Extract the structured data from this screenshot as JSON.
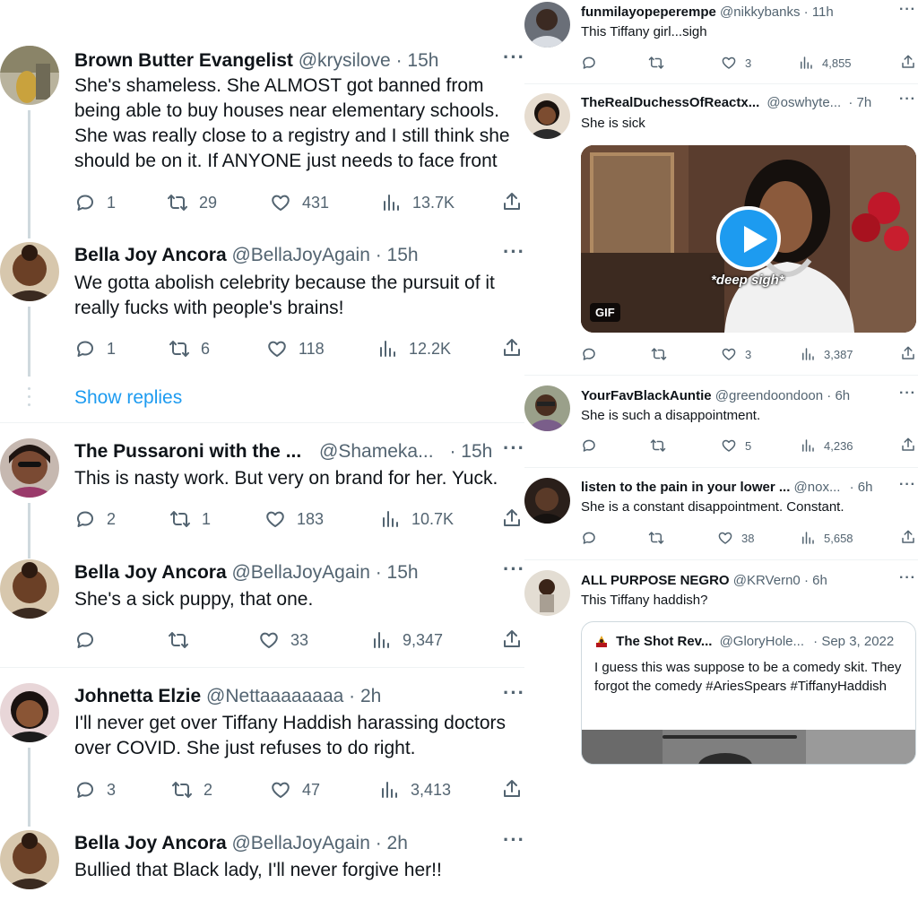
{
  "left": {
    "tweets": [
      {
        "name": "Brown Butter Evangelist",
        "handle": "@krysilove",
        "time": "· 15h",
        "text": "She's shameless. She ALMOST got banned from being able to buy houses near elementary schools. She was really close to a registry and I still think she should be on it. If ANYONE just needs to face front",
        "replies": "1",
        "retweets": "29",
        "likes": "431",
        "views": "13.7K"
      },
      {
        "name": "Bella Joy Ancora",
        "handle": "@BellaJoyAgain",
        "time": "· 15h",
        "text": "We gotta abolish celebrity because the pursuit of it really fucks with people's brains!",
        "replies": "1",
        "retweets": "6",
        "likes": "118",
        "views": "12.2K"
      },
      {
        "name": "The Pussaroni with the ...",
        "handle": "@Shameka...",
        "time": "· 15h",
        "text": "This is nasty work. But very on brand for her. Yuck.",
        "replies": "2",
        "retweets": "1",
        "likes": "183",
        "views": "10.7K"
      },
      {
        "name": "Bella Joy Ancora",
        "handle": "@BellaJoyAgain",
        "time": "· 15h",
        "text": "She's a sick puppy, that one.",
        "replies": "",
        "retweets": "",
        "likes": "33",
        "views": "9,347"
      },
      {
        "name": "Johnetta Elzie",
        "handle": "@Nettaaaaaaaa",
        "time": "· 2h",
        "text": "I'll never get over Tiffany Haddish harassing doctors over COVID. She just refuses to do right.",
        "replies": "3",
        "retweets": "2",
        "likes": "47",
        "views": "3,413"
      },
      {
        "name": "Bella Joy Ancora",
        "handle": "@BellaJoyAgain",
        "time": "· 2h",
        "text": "Bullied that Black lady, I'll never forgive her!!"
      }
    ],
    "show_replies": "Show replies"
  },
  "right": {
    "tweets": [
      {
        "name": "funmilayopeperempe",
        "handle": "@nikkybanks",
        "time": "· 11h",
        "text": "This Tiffany girl...sigh",
        "replies": "",
        "retweets": "",
        "likes": "3",
        "views": "4,855"
      },
      {
        "name": "TheRealDuchessOfReactx...",
        "handle": "@oswhyte...",
        "time": "· 7h",
        "text": "She is sick",
        "replies": "",
        "retweets": "",
        "likes": "3",
        "views": "3,387",
        "gif_badge": "GIF",
        "gif_caption": "*deep sigh*"
      },
      {
        "name": "YourFavBlackAuntie",
        "handle": "@greendoondoon",
        "time": "· 6h",
        "text": "She is such a disappointment.",
        "replies": "",
        "retweets": "",
        "likes": "5",
        "views": "4,236"
      },
      {
        "name": "listen to the pain in your lower ...",
        "handle": "@nox...",
        "time": "· 6h",
        "text": "She is a constant disappointment. Constant.",
        "replies": "",
        "retweets": "",
        "likes": "38",
        "views": "5,658"
      },
      {
        "name": "ALL PURPOSE NEGRO",
        "handle": "@KRVern0",
        "time": "· 6h",
        "text": "This Tiffany haddish?"
      }
    ],
    "quote": {
      "name": "The Shot Rev...",
      "handle": "@GloryHole...",
      "date": "· Sep 3, 2022",
      "text": "I guess this was suppose to be a comedy skit. They forgot the comedy #AriesSpears #TiffanyHaddish"
    }
  },
  "colors": {
    "accent": "#1d9bf0",
    "muted": "#536471",
    "text": "#0f1419",
    "divider": "#eff3f4"
  },
  "icons": [
    "reply-icon",
    "retweet-icon",
    "like-icon",
    "views-icon",
    "share-icon",
    "more-icon",
    "play-icon"
  ]
}
